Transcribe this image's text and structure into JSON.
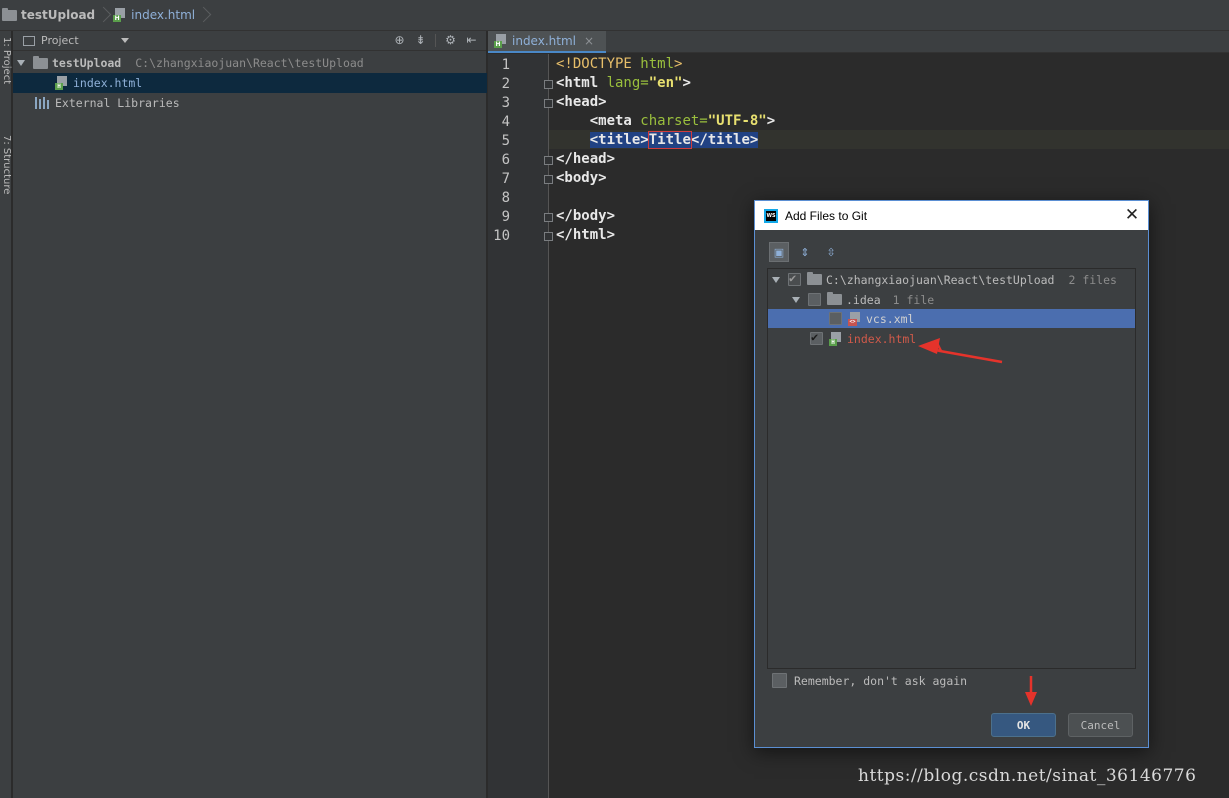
{
  "breadcrumb": {
    "project": "testUpload",
    "file": "index.html"
  },
  "left_strip": {
    "project_tab": "1: Project",
    "structure_tab": "7: Structure"
  },
  "project_panel": {
    "header_title": "Project",
    "tree": [
      {
        "label": "testUpload",
        "path": "C:\\zhangxiaojuan\\React\\testUpload"
      },
      {
        "label": "index.html"
      },
      {
        "label": "External Libraries"
      }
    ]
  },
  "editor": {
    "tab_name": "index.html",
    "line_numbers": [
      "1",
      "2",
      "3",
      "4",
      "5",
      "6",
      "7",
      "8",
      "9",
      "10"
    ]
  },
  "dialog": {
    "title": "Add Files to Git",
    "tree": {
      "root": {
        "label": "C:\\zhangxiaojuan\\React\\testUpload",
        "count": "2 files"
      },
      "idea": {
        "label": ".idea",
        "count": "1 file"
      },
      "vcs": {
        "label": "vcs.xml"
      },
      "index": {
        "label": "index.html"
      }
    },
    "remember_label": "Remember, don't ask again",
    "ok_label": "OK",
    "cancel_label": "Cancel"
  },
  "watermark": "https://blog.csdn.net/sinat_36146776",
  "colors": {
    "annotation_arrow": "#e5332b",
    "selection": "#4b6eaf",
    "ok_button": "#365880"
  }
}
